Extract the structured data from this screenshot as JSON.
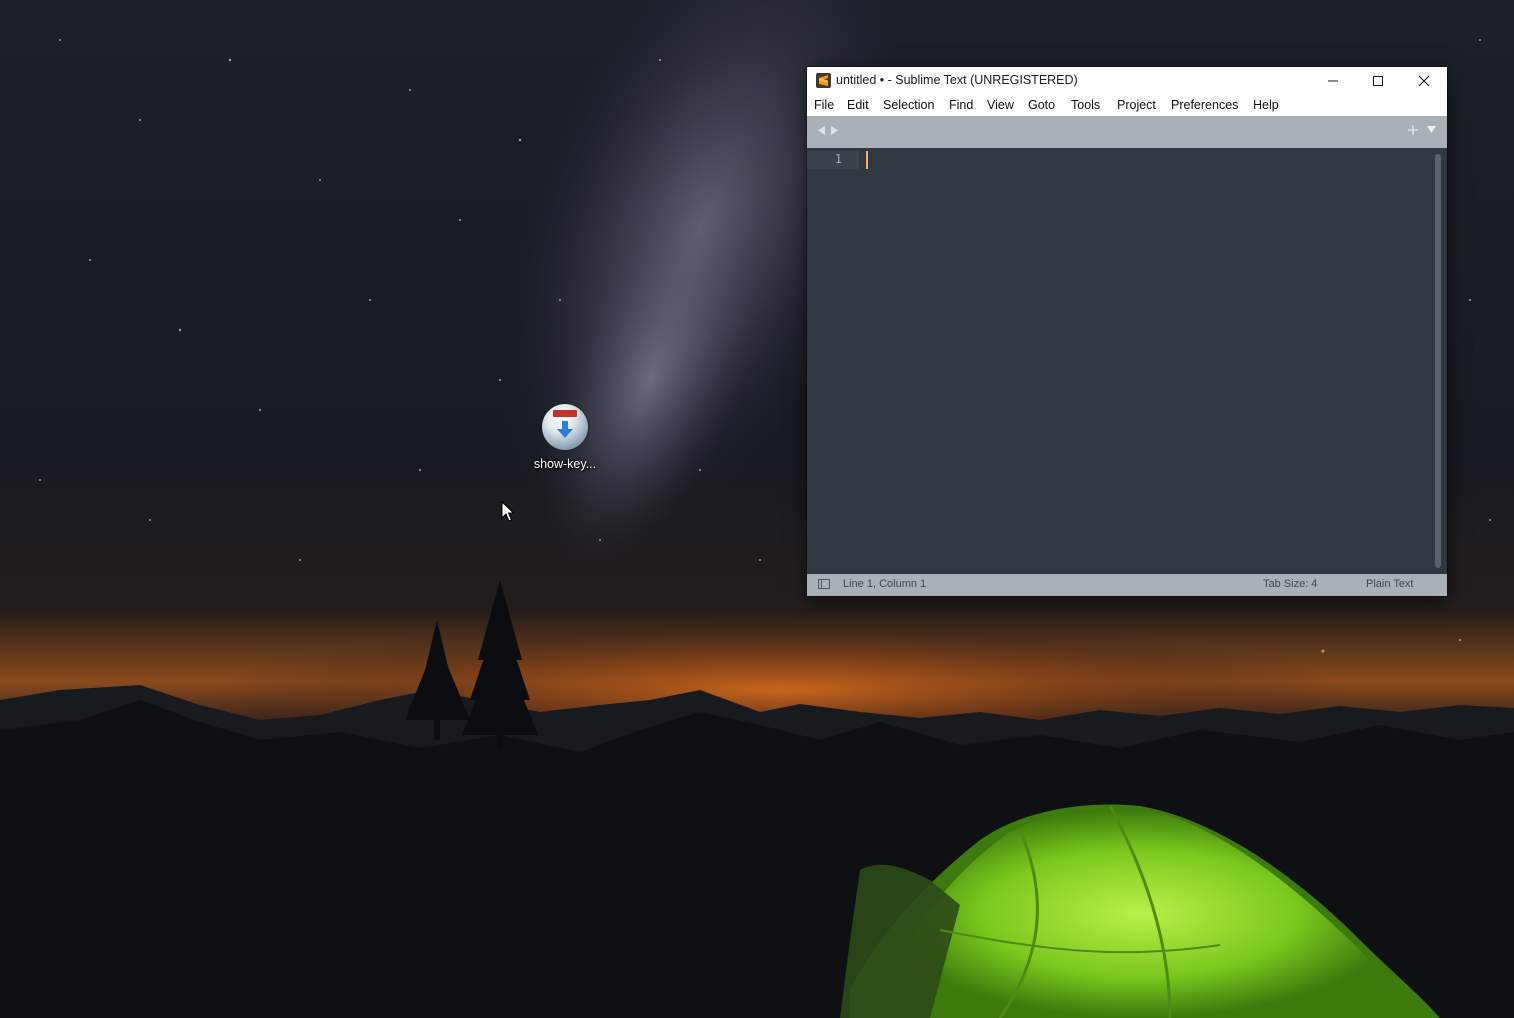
{
  "desktop": {
    "icon_label": "show-key..."
  },
  "window": {
    "title": "untitled • - Sublime Text (UNREGISTERED)",
    "menu": [
      "File",
      "Edit",
      "Selection",
      "Find",
      "View",
      "Goto",
      "Tools",
      "Project",
      "Preferences",
      "Help"
    ],
    "editor": {
      "line_numbers": [
        "1"
      ],
      "content": ""
    },
    "statusbar": {
      "position": "Line 1, Column 1",
      "tab_size": "Tab Size: 4",
      "syntax": "Plain Text"
    }
  },
  "icons": {
    "app": "sublime-text-icon",
    "minimize": "minimize-icon",
    "maximize": "maximize-icon",
    "close": "close-icon",
    "tab_left": "chevron-left-icon",
    "tab_right": "chevron-right-icon",
    "new_tab": "plus-icon",
    "tab_list": "chevron-down-icon",
    "panel_toggle": "panel-toggle-icon",
    "desktop_app": "show-key-app-icon",
    "cursor": "mouse-pointer-icon"
  },
  "colors": {
    "editor_bg": "#303841",
    "caret": "#f9ae58",
    "tabbar_bg": "#a9b0b6",
    "line_number": "#a6acb2"
  }
}
